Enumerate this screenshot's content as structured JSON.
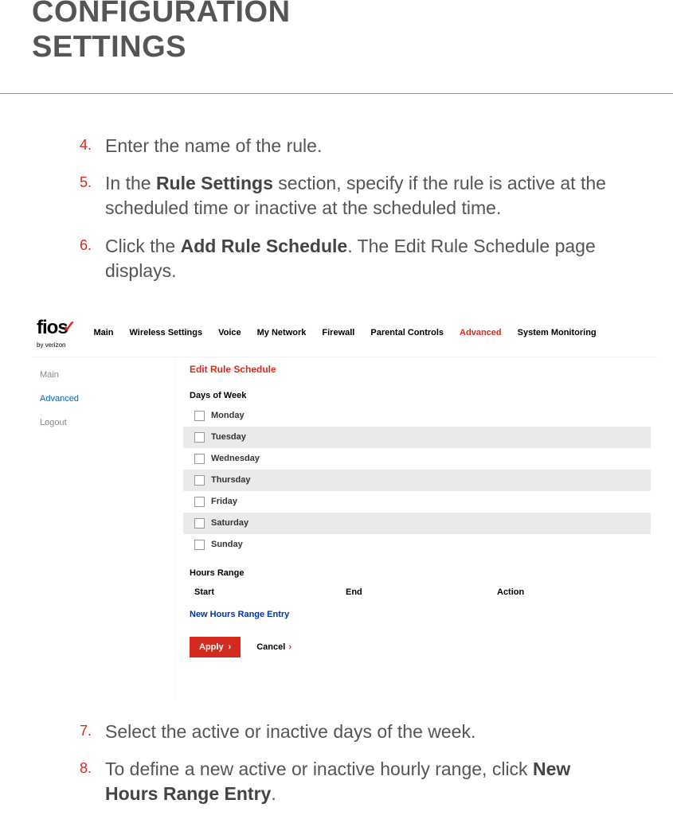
{
  "title_line1": "CONFIGURATION",
  "title_line2": "SETTINGS",
  "steps_before": [
    {
      "n": "4.",
      "text": "Enter the name of the rule."
    },
    {
      "n": "5.",
      "pre": "In the ",
      "bold": "Rule Settings",
      "post": " section, specify if the rule is active at the scheduled time or inactive at the scheduled time."
    },
    {
      "n": "6.",
      "pre": "Click the ",
      "bold": "Add Rule Schedule",
      "post": ". The Edit Rule Schedule page displays."
    }
  ],
  "steps_after": [
    {
      "n": "7.",
      "text": "Select the active or inactive days of the week."
    },
    {
      "n": "8.",
      "pre": "To define a new active or inactive hourly range, click ",
      "bold": "New Hours Range Entry",
      "post": "."
    }
  ],
  "ui": {
    "logo": {
      "main": "fios",
      "sub": "by verizon",
      "check": "✓"
    },
    "nav": [
      "Main",
      "Wireless Settings",
      "Voice",
      "My Network",
      "Firewall",
      "Parental Controls",
      "Advanced",
      "System Monitoring"
    ],
    "nav_active_index": 6,
    "side": [
      {
        "label": "Main",
        "selected": false
      },
      {
        "label": "Advanced",
        "selected": true
      },
      {
        "label": "Logout",
        "selected": false
      }
    ],
    "panel_title": "Edit Rule Schedule",
    "days_label": "Days of Week",
    "days": [
      "Monday",
      "Tuesday",
      "Wednesday",
      "Thursday",
      "Friday",
      "Saturday",
      "Sunday"
    ],
    "hours_label": "Hours Range",
    "hours_cols": {
      "c1": "Start",
      "c2": "End",
      "c3": "Action"
    },
    "new_entry": "New Hours Range Entry",
    "apply": "Apply",
    "cancel": "Cancel"
  }
}
